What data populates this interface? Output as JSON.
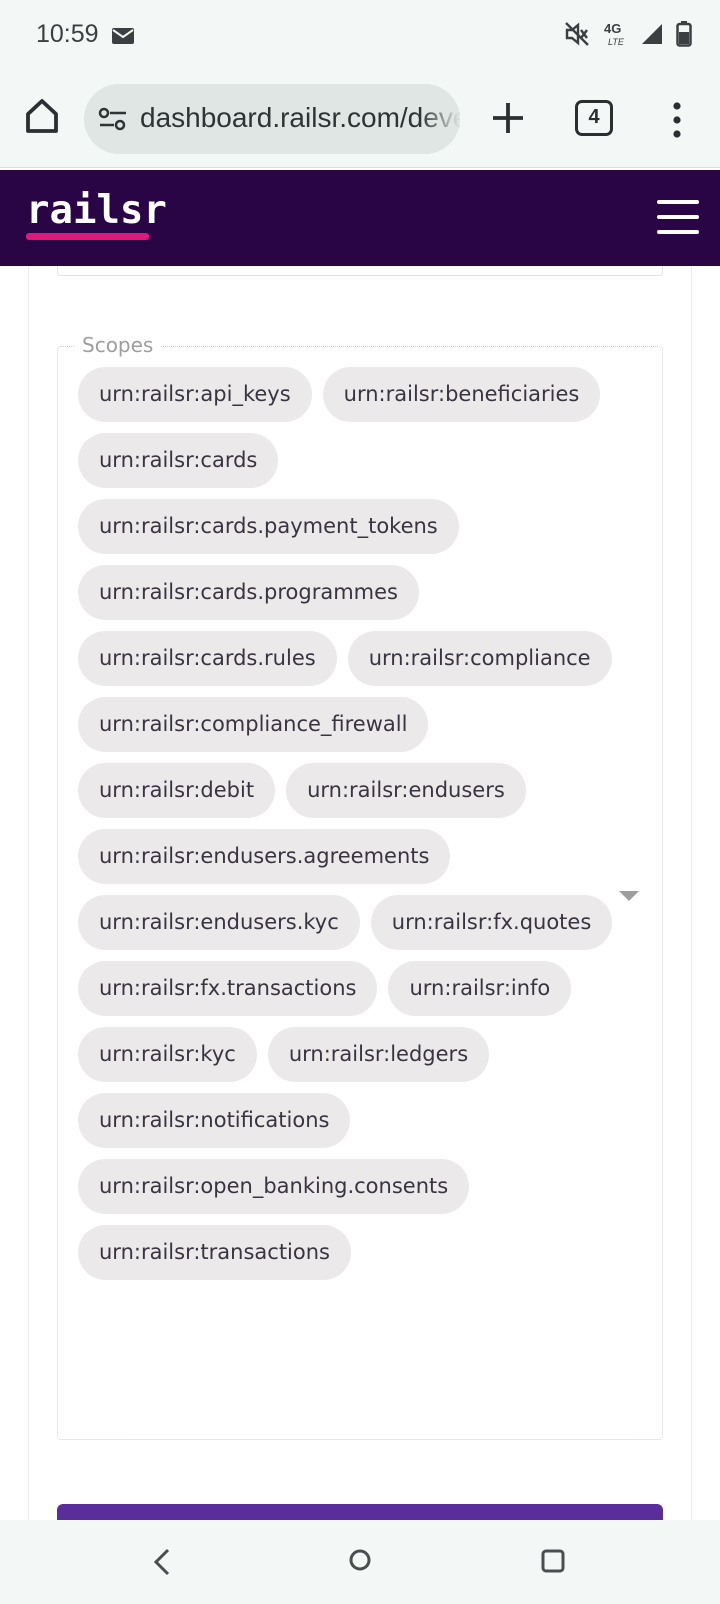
{
  "status_bar": {
    "time": "10:59",
    "network_label": "4G LTE",
    "icons": [
      "mail-icon",
      "mute-icon",
      "network-4g-icon",
      "signal-icon",
      "battery-icon"
    ]
  },
  "browser": {
    "url": "dashboard.railsr.com/developer",
    "tab_count": "4",
    "icons": [
      "home-icon",
      "site-settings-icon",
      "plus-icon",
      "more-vert-icon"
    ]
  },
  "header": {
    "logo_text": "railsr",
    "brand_color": "#2a0545",
    "accent_color": "#e0187a",
    "icons": [
      "hamburger-menu-icon"
    ]
  },
  "scopes": {
    "legend": "Scopes",
    "chips": [
      "urn:railsr:api_keys",
      "urn:railsr:beneficiaries",
      "urn:railsr:cards",
      "urn:railsr:cards.payment_tokens",
      "urn:railsr:cards.programmes",
      "urn:railsr:cards.rules",
      "urn:railsr:compliance",
      "urn:railsr:compliance_firewall",
      "urn:railsr:debit",
      "urn:railsr:endusers",
      "urn:railsr:endusers.agreements",
      "urn:railsr:endusers.kyc",
      "urn:railsr:fx.quotes",
      "urn:railsr:fx.transactions",
      "urn:railsr:info",
      "urn:railsr:kyc",
      "urn:railsr:ledgers",
      "urn:railsr:notifications",
      "urn:railsr:open_banking.consents",
      "urn:railsr:transactions"
    ]
  },
  "submit_button": {
    "color": "#5b2d9a"
  },
  "nav_bar": {
    "icons": [
      "back-icon",
      "home-circle-icon",
      "recents-icon"
    ]
  }
}
